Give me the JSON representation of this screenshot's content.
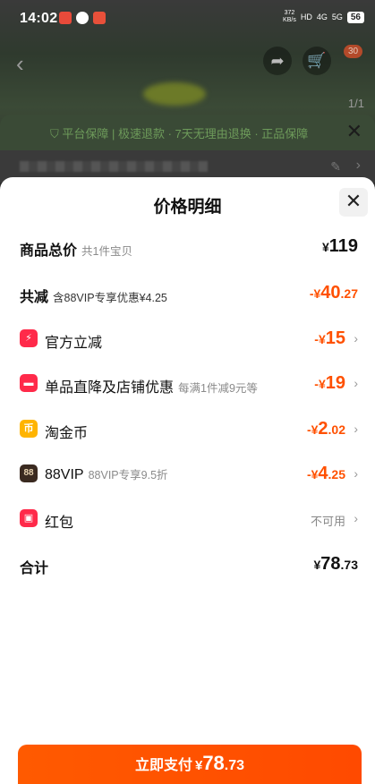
{
  "status_bar": {
    "time": "14:02",
    "speed_top": "372",
    "speed_bottom": "KB/s",
    "network": "4G",
    "network2": "5G",
    "battery": "56"
  },
  "background": {
    "image_index": "1/1",
    "cart_badge": "30",
    "guarantee_text": "平台保障 | 极速退款 · 7天无理由退换 · 正品保障"
  },
  "sheet": {
    "title": "价格明细",
    "rows": {
      "total": {
        "label": "商品总价",
        "sub": "共1件宝贝",
        "currency": "¥",
        "int": "119",
        "dec": ""
      },
      "reduce": {
        "label": "共减",
        "sub": "含88VIP专享优惠¥4.25",
        "prefix": "-¥",
        "int": "40",
        "dec": ".27"
      },
      "official": {
        "icon_glyph": "⚡",
        "label": "官方立减",
        "prefix": "-¥",
        "int": "15",
        "dec": ""
      },
      "shop": {
        "icon_glyph": "▬",
        "label": "单品直降及店铺优惠",
        "sub": "每满1件减9元等",
        "prefix": "-¥",
        "int": "19",
        "dec": ""
      },
      "coin": {
        "icon_glyph": "币",
        "label": "淘金币",
        "prefix": "-¥",
        "int": "2",
        "dec": ".02"
      },
      "vip": {
        "icon_glyph": "88",
        "label": "88VIP",
        "sub": "88VIP专享9.5折",
        "prefix": "-¥",
        "int": "4",
        "dec": ".25"
      },
      "redpacket": {
        "icon_glyph": "▣",
        "label": "红包",
        "status": "不可用"
      },
      "sum": {
        "label": "合计",
        "currency": "¥",
        "int": "78",
        "dec": ".73"
      }
    }
  },
  "pay_button": {
    "label": "立即支付",
    "currency": "¥",
    "int": "78",
    "dec": ".73"
  },
  "colors": {
    "accent": "#ff5000",
    "icon_red": "#ff2a4a",
    "icon_yellow": "#ffb400",
    "icon_dark": "#3a2a20"
  }
}
